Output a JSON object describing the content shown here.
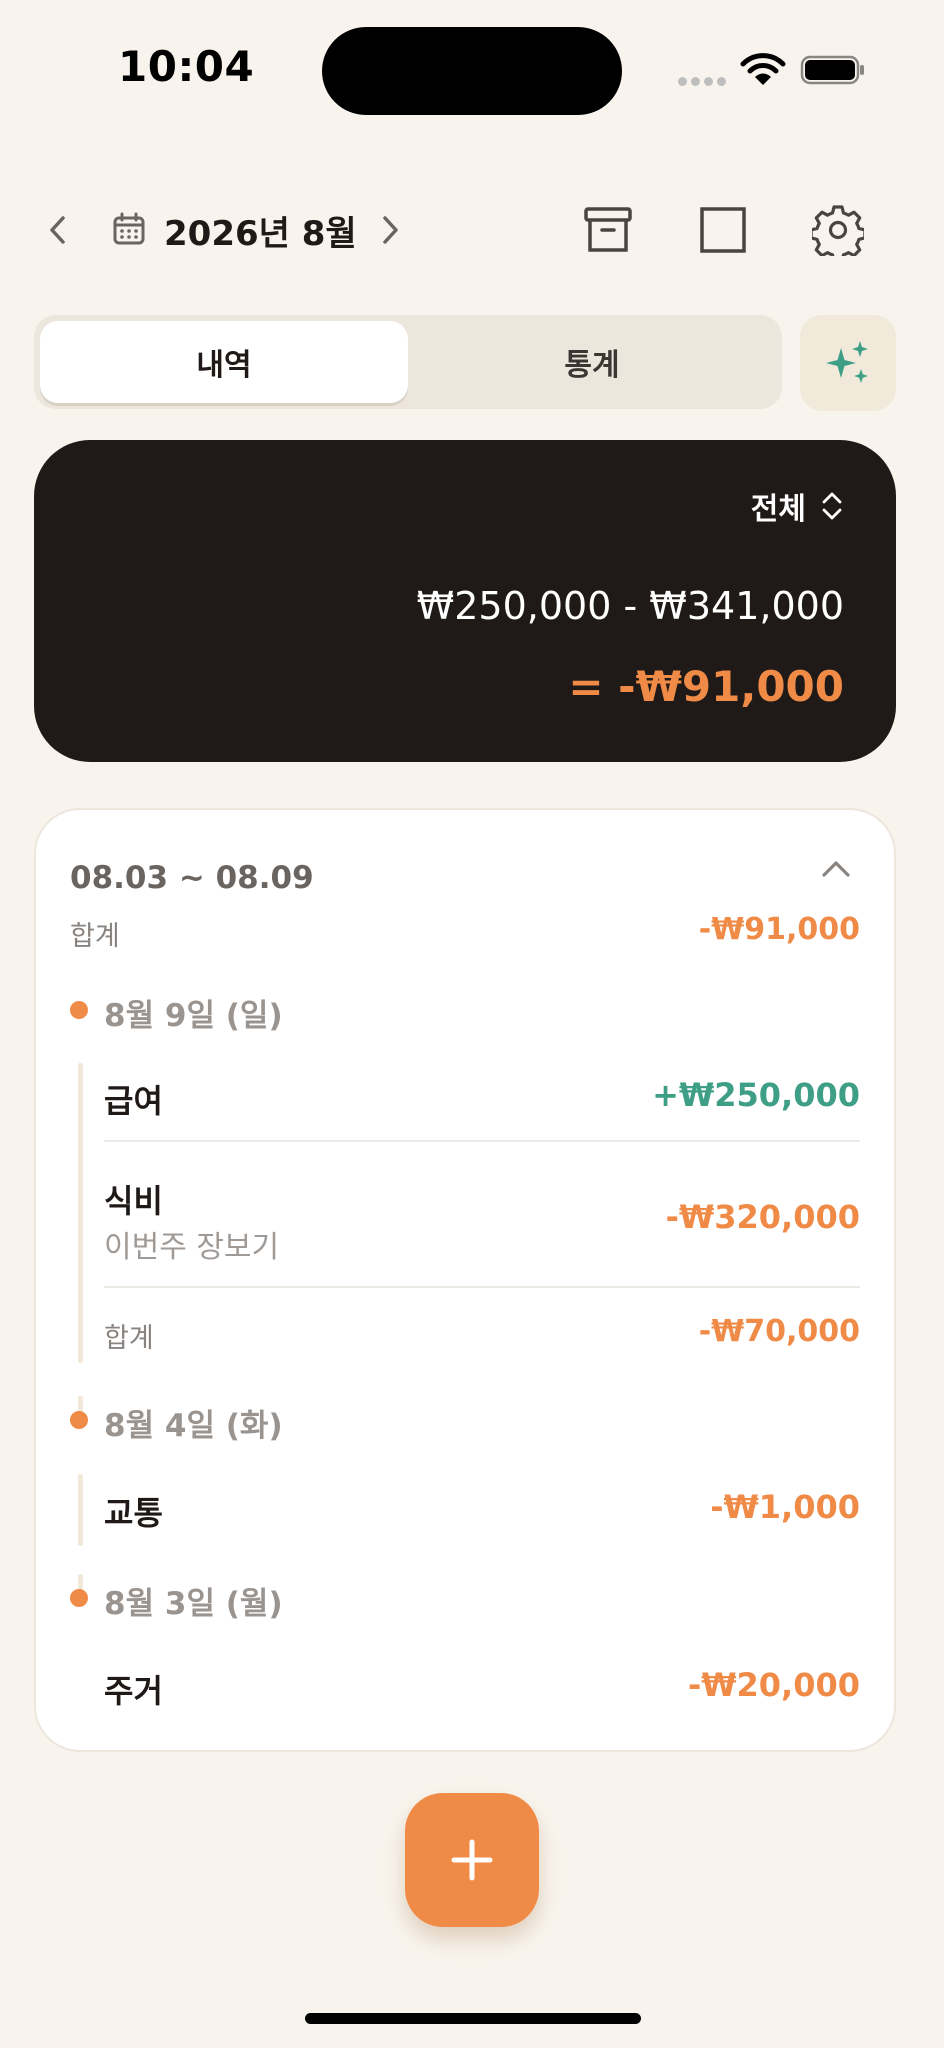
{
  "status_bar": {
    "time": "10:04"
  },
  "header": {
    "month_title": "2026년 8월"
  },
  "tabs": {
    "history": "내역",
    "stats": "통계"
  },
  "summary": {
    "filter_label": "전체",
    "income": "₩250,000",
    "minus": "-",
    "expense": "₩341,000",
    "net": "= -₩91,000"
  },
  "week": {
    "range": "08.03 ~ 08.09",
    "total_label": "합계",
    "total_value": "-₩91,000",
    "days": [
      {
        "label": "8월 9일 (일)",
        "transactions": [
          {
            "name": "급여",
            "memo": "",
            "amount": "+₩250,000"
          },
          {
            "name": "식비",
            "memo": "이번주 장보기",
            "amount": "-₩320,000"
          }
        ],
        "total_label": "합계",
        "total_value": "-₩70,000"
      },
      {
        "label": "8월 4일 (화)",
        "transactions": [
          {
            "name": "교통",
            "memo": "",
            "amount": "-₩1,000"
          }
        ]
      },
      {
        "label": "8월 3일 (월)",
        "transactions": [
          {
            "name": "주거",
            "memo": "",
            "amount": "-₩20,000"
          }
        ]
      }
    ]
  },
  "fab": {
    "label": "+"
  },
  "colors": {
    "background": "#F8F4ED",
    "dark_card": "#1F1A17",
    "accent_orange": "#F08A47",
    "income_green": "#3E9E86"
  }
}
